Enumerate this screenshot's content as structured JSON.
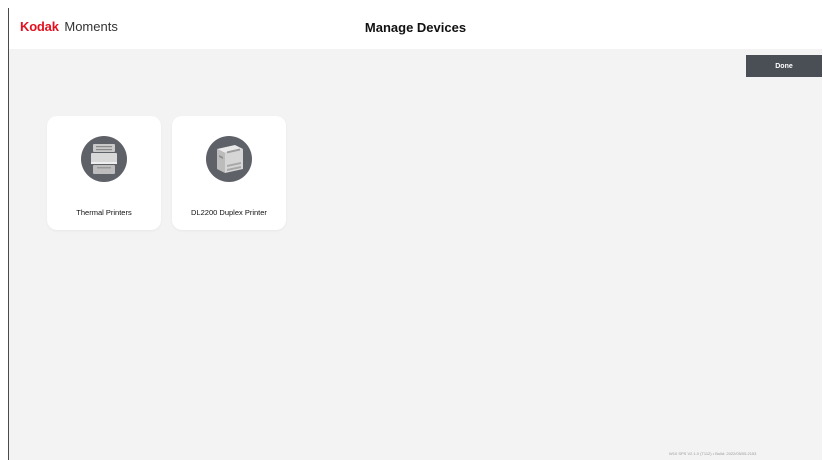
{
  "header": {
    "brand_kodak": "Kodak",
    "brand_moments": "Moments",
    "title": "Manage Devices"
  },
  "actions": {
    "done_label": "Done"
  },
  "devices": [
    {
      "label": "Thermal Printers",
      "icon": "thermal-printer-icon"
    },
    {
      "label": "DL2200 Duplex Printer",
      "icon": "duplex-printer-icon"
    }
  ],
  "footer": {
    "version": "W10 SPS V2.1.0 (T112) • Build: 2022/05/05.2153"
  },
  "colors": {
    "brand_red": "#e3101f",
    "button_bg": "#4a4e55",
    "background": "#f3f3f3",
    "icon_circle": "#5f6168"
  }
}
